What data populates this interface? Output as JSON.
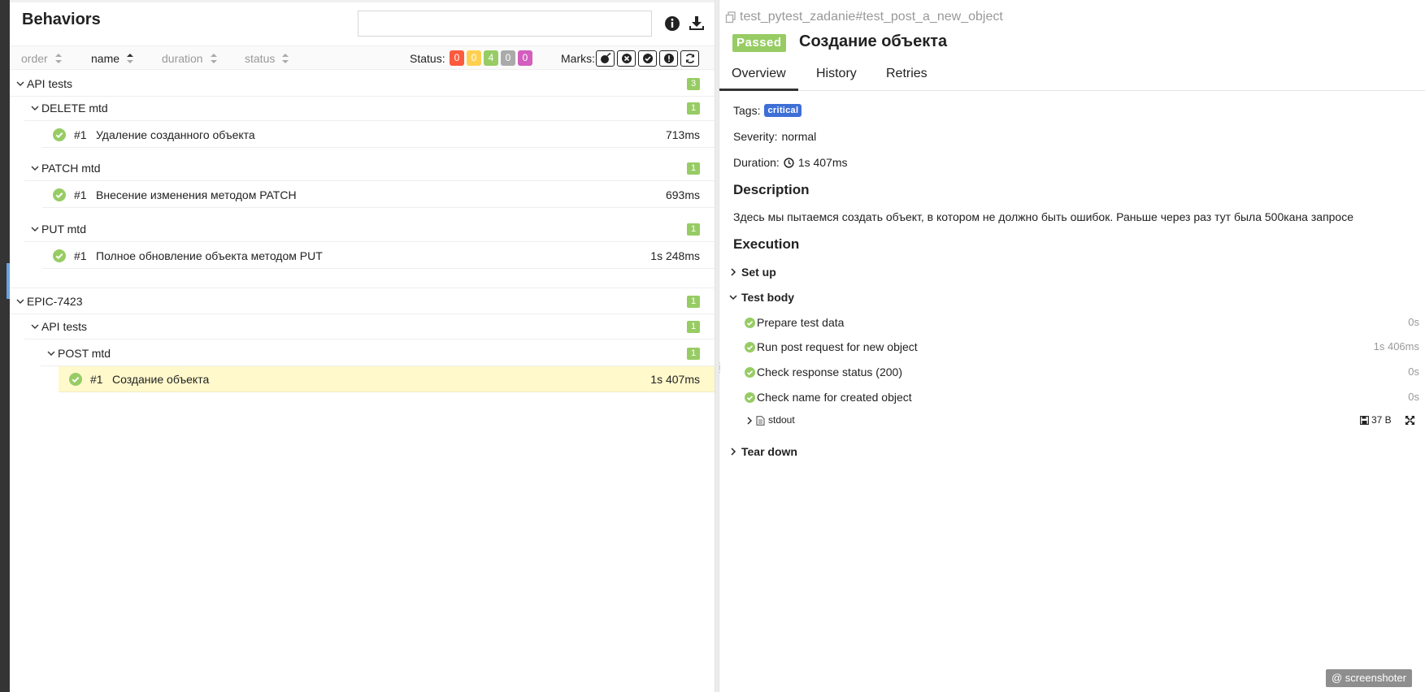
{
  "left": {
    "title": "Behaviors",
    "search": {
      "value": "",
      "placeholder": ""
    },
    "sort": [
      "order",
      "name",
      "duration",
      "status"
    ],
    "status_label": "Status:",
    "status_counts": [
      {
        "value": "0",
        "color": "#fd5a3e"
      },
      {
        "value": "0",
        "color": "#ffd050"
      },
      {
        "value": "4",
        "color": "#97cc64"
      },
      {
        "value": "0",
        "color": "#aaaaaa"
      },
      {
        "value": "0",
        "color": "#d35ebe"
      }
    ],
    "marks_label": "Marks:",
    "marks": [
      "flaky-icon",
      "new-failed-icon",
      "new-passed-icon",
      "new-broken-icon",
      "retries-icon"
    ],
    "groups": [
      {
        "title": "API tests",
        "count": "3"
      },
      {
        "title": "DELETE mtd",
        "count": "1"
      },
      {
        "title": "PATCH mtd",
        "count": "1"
      },
      {
        "title": "PUT mtd",
        "count": "1"
      },
      {
        "title": "EPIC-7423",
        "count": "1"
      },
      {
        "title": "API tests",
        "count": "1"
      },
      {
        "title": "POST mtd",
        "count": "1"
      }
    ],
    "tests": [
      {
        "num": "#1",
        "name": "Удаление созданного объекта",
        "duration": "713ms"
      },
      {
        "num": "#1",
        "name": "Внесение изменения методом PATCH",
        "duration": "693ms"
      },
      {
        "num": "#1",
        "name": "Полное обновление объекта методом PUT",
        "duration": "1s 248ms"
      },
      {
        "num": "#1",
        "name": "Создание объекта",
        "duration": "1s 407ms"
      }
    ]
  },
  "right": {
    "full_name": "test_pytest_zadanie#test_post_a_new_object",
    "status": "Passed",
    "title": "Создание объекта",
    "tabs": [
      "Overview",
      "History",
      "Retries"
    ],
    "tags_label": "Tags:",
    "tag": "critical",
    "severity_label": "Severity:",
    "severity": "normal",
    "duration_label": "Duration:",
    "duration": "1s 407ms",
    "description_heading": "Description",
    "description": "Здесь мы пытаемся создать объект, в котором не должно быть ошибок. Раньше через раз тут была 500кана запросе",
    "execution_heading": "Execution",
    "setup": "Set up",
    "test_body": "Test body",
    "steps": [
      {
        "name": "Prepare test data",
        "duration": "0s"
      },
      {
        "name": "Run post request for new object",
        "duration": "1s 406ms"
      },
      {
        "name": "Check response status (200)",
        "duration": "0s"
      },
      {
        "name": "Check name for created object",
        "duration": "0s"
      }
    ],
    "attachment": {
      "name": "stdout",
      "size": "37 B"
    },
    "teardown": "Tear down"
  },
  "watermark": "@ screenshoter"
}
